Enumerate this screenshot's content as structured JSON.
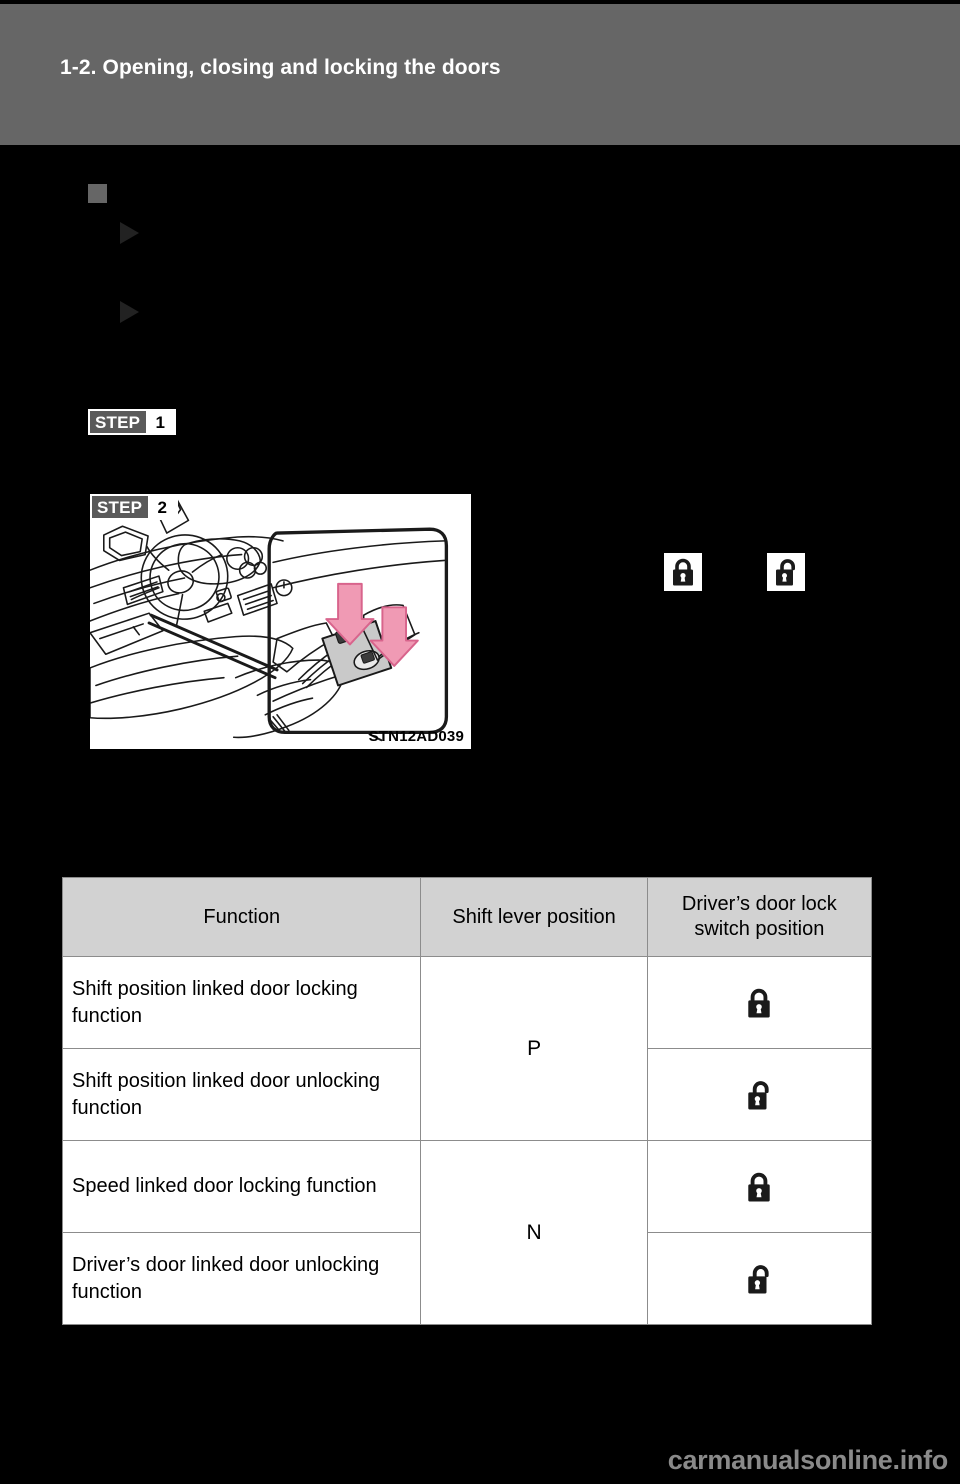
{
  "page": {
    "header_title": "1-2. Opening, closing and locking the doors",
    "watermark": "carmanualsonline.info"
  },
  "steps": [
    {
      "word": "STEP",
      "number": "1"
    },
    {
      "word": "STEP",
      "number": "2"
    }
  ],
  "figure": {
    "caption": "STN12AD039",
    "description": "vehicle-interior-door-lock-switch-illustration",
    "arrow_color": "#f09ab4",
    "switch_color": "#c9c9c9"
  },
  "inline_icons": [
    {
      "name": "lock-closed-icon",
      "state": "locked"
    },
    {
      "name": "lock-open-icon",
      "state": "unlocked"
    }
  ],
  "table": {
    "headers": [
      "Function",
      "Shift lever position",
      "Driver’s door lock switch position"
    ],
    "header_lines": {
      "col3_line1": "Driver’s door lock",
      "col3_line2": "switch position"
    },
    "rows": [
      {
        "function": "Shift position linked door locking function",
        "shift": "P",
        "lock_state": "locked"
      },
      {
        "function": "Shift position linked door unlocking function",
        "shift": "",
        "lock_state": "unlocked"
      },
      {
        "function": "Speed linked door locking function",
        "shift": "N",
        "lock_state": "locked"
      },
      {
        "function": "Driver’s door linked door unlocking function",
        "shift": "",
        "lock_state": "unlocked"
      }
    ],
    "shift_groups": [
      {
        "label": "P",
        "rowspan": 2
      },
      {
        "label": "N",
        "rowspan": 2
      }
    ]
  },
  "colors": {
    "header_band": "#666666",
    "page_background": "#000000",
    "table_header_fill": "#d2d2d2",
    "table_border": "#8c8c8c",
    "watermark": "#8a8a8a"
  }
}
